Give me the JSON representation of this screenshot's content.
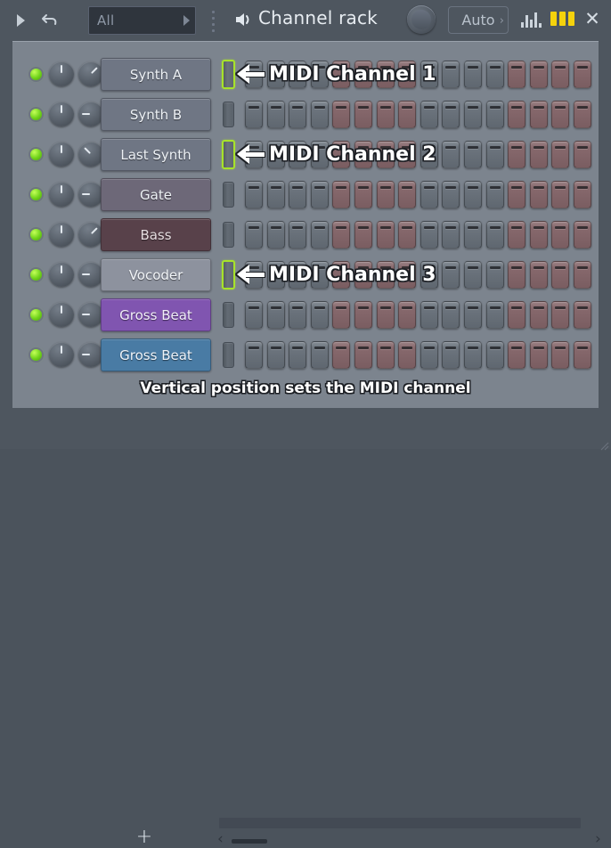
{
  "window": {
    "title": "Channel rack",
    "bg_color": "#4e565f",
    "panel_color": "#7c848e"
  },
  "toolbar": {
    "play_icon": "play-arrow-icon",
    "undo_icon": "undo-arrow-icon",
    "pattern_selector_value": "All",
    "pattern_selector_arrow": "chevron-right-icon",
    "menu_icon": "vertical-dots-icon",
    "speaker_icon": "speaker-icon",
    "knob_icon": "master-knob",
    "auto_label": "Auto",
    "auto_chevron": "chevron-right-icon",
    "eq_icon": "bar-graph-icon",
    "leds_icon": "yellow-leds-icon",
    "close_icon": "close-x-icon"
  },
  "channels": [
    {
      "name": "Synth A",
      "color": "#6f7684",
      "text_color": "#eef2f6",
      "led": true,
      "pan_angle": 45,
      "midi_highlight": true
    },
    {
      "name": "Synth B",
      "color": "#6f7684",
      "text_color": "#eef2f6",
      "led": true,
      "pan_angle": 270,
      "midi_highlight": false
    },
    {
      "name": "Last Synth",
      "color": "#6f7684",
      "text_color": "#eef2f6",
      "led": true,
      "pan_angle": 315,
      "midi_highlight": true
    },
    {
      "name": "Gate",
      "color": "#6d6878",
      "text_color": "#eef2f6",
      "led": true,
      "pan_angle": 270,
      "midi_highlight": false
    },
    {
      "name": "Bass",
      "color": "#58414a",
      "text_color": "#e6dde0",
      "led": true,
      "pan_angle": 45,
      "midi_highlight": false
    },
    {
      "name": "Vocoder",
      "color": "#8d929e",
      "text_color": "#f2f5f8",
      "led": true,
      "pan_angle": 270,
      "midi_highlight": true
    },
    {
      "name": "Gross Beat",
      "color": "#8055b0",
      "text_color": "#f2eefa",
      "led": true,
      "pan_angle": 270,
      "midi_highlight": false
    },
    {
      "name": "Gross Beat",
      "color": "#497ba4",
      "text_color": "#eef4fa",
      "led": true,
      "pan_angle": 270,
      "midi_highlight": false
    }
  ],
  "step_sequencer": {
    "step_count": 16,
    "beat_group_size": 4,
    "group_colors": [
      "gray",
      "red",
      "gray",
      "red"
    ],
    "gray_color": "#6d757e",
    "red_color": "#87696d"
  },
  "annotations": {
    "highlight_color": "#a8e32a",
    "callouts": [
      {
        "text": "MIDI Channel 1",
        "row": 0
      },
      {
        "text": "MIDI Channel 2",
        "row": 2
      },
      {
        "text": "MIDI Channel 3",
        "row": 5
      }
    ],
    "footer_note": "Vertical position sets the MIDI channel"
  },
  "footer": {
    "add_label": "+",
    "nav_left_icon": "chevron-left-icon",
    "nav_right_icon": "chevron-right-icon",
    "scrollbar": "horizontal-scrollbar"
  }
}
